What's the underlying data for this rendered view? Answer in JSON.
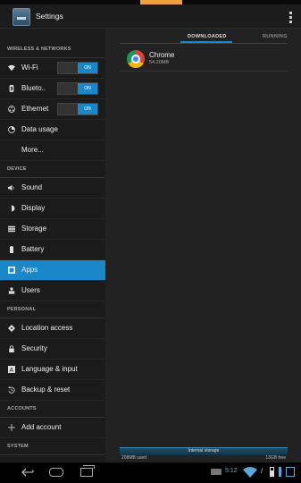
{
  "action_bar": {
    "title": "Settings"
  },
  "sidebar": {
    "sections": [
      {
        "header": "WIRELESS & NETWORKS"
      },
      {
        "header": "DEVICE"
      },
      {
        "header": "PERSONAL"
      },
      {
        "header": "ACCOUNTS"
      },
      {
        "header": "SYSTEM"
      }
    ],
    "items": {
      "wifi": {
        "label": "Wi-Fi",
        "toggle": "ON"
      },
      "bluetooth": {
        "label": "Blueto..",
        "toggle": "ON"
      },
      "ethernet": {
        "label": "Ethernet",
        "toggle": "ON"
      },
      "data_usage": {
        "label": "Data usage"
      },
      "more": {
        "label": "More..."
      },
      "sound": {
        "label": "Sound"
      },
      "display": {
        "label": "Display"
      },
      "storage": {
        "label": "Storage"
      },
      "battery": {
        "label": "Battery"
      },
      "apps": {
        "label": "Apps"
      },
      "users": {
        "label": "Users"
      },
      "location": {
        "label": "Location access"
      },
      "security": {
        "label": "Security"
      },
      "language": {
        "label": "Language & input"
      },
      "backup": {
        "label": "Backup & reset"
      },
      "add_account": {
        "label": "Add account"
      }
    }
  },
  "main": {
    "tabs": {
      "downloaded": "DOWNLOADED",
      "running": "RUNNING"
    },
    "apps": [
      {
        "name": "Chrome",
        "size": "54.20MB"
      }
    ],
    "storage": {
      "label": "Internal storage",
      "used": "208MB used",
      "free": "13GB free"
    }
  },
  "system_bar": {
    "time": "5:12"
  },
  "colors": {
    "accent": "#1a88c8",
    "background": "#1b1b1b"
  }
}
